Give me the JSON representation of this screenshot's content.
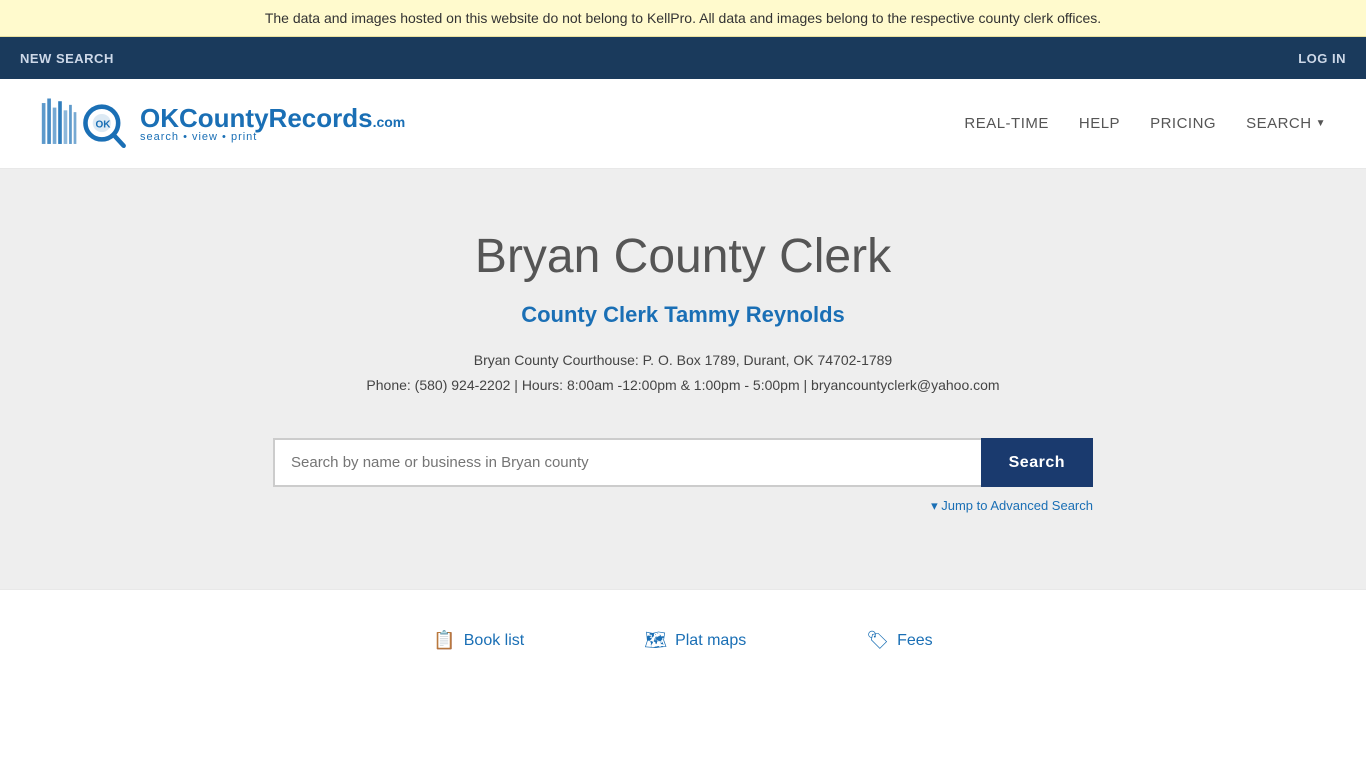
{
  "notice": {
    "text": "The data and images hosted on this website do not belong to KellPro. All data and images belong to the respective county clerk offices."
  },
  "nav": {
    "new_search": "NEW SEARCH",
    "log_in": "LOG IN"
  },
  "header": {
    "brand": "OKCountyRecords",
    "brand_com": ".com",
    "tagline": "search • view • print",
    "nav_items": [
      {
        "label": "REAL-TIME",
        "id": "real-time"
      },
      {
        "label": "HELP",
        "id": "help"
      },
      {
        "label": "PRICING",
        "id": "pricing"
      },
      {
        "label": "SEARCH",
        "id": "search"
      }
    ]
  },
  "main": {
    "title": "Bryan County Clerk",
    "clerk_name": "County Clerk Tammy Reynolds",
    "address_line1": "Bryan County Courthouse: P. O. Box 1789, Durant, OK 74702-1789",
    "address_line2": "Phone: (580) 924-2202 | Hours: 8:00am -12:00pm & 1:00pm - 5:00pm | bryancountyclerk@yahoo.com",
    "search_placeholder": "Search by name or business in Bryan county",
    "search_button_label": "Search",
    "advanced_search_label": "▾ Jump to Advanced Search"
  },
  "footer": {
    "links": [
      {
        "label": "Book list",
        "icon": "📋",
        "id": "book-list"
      },
      {
        "label": "Plat maps",
        "icon": "🗺",
        "id": "plat-maps"
      },
      {
        "label": "Fees",
        "icon": "🏷",
        "id": "fees"
      }
    ]
  }
}
